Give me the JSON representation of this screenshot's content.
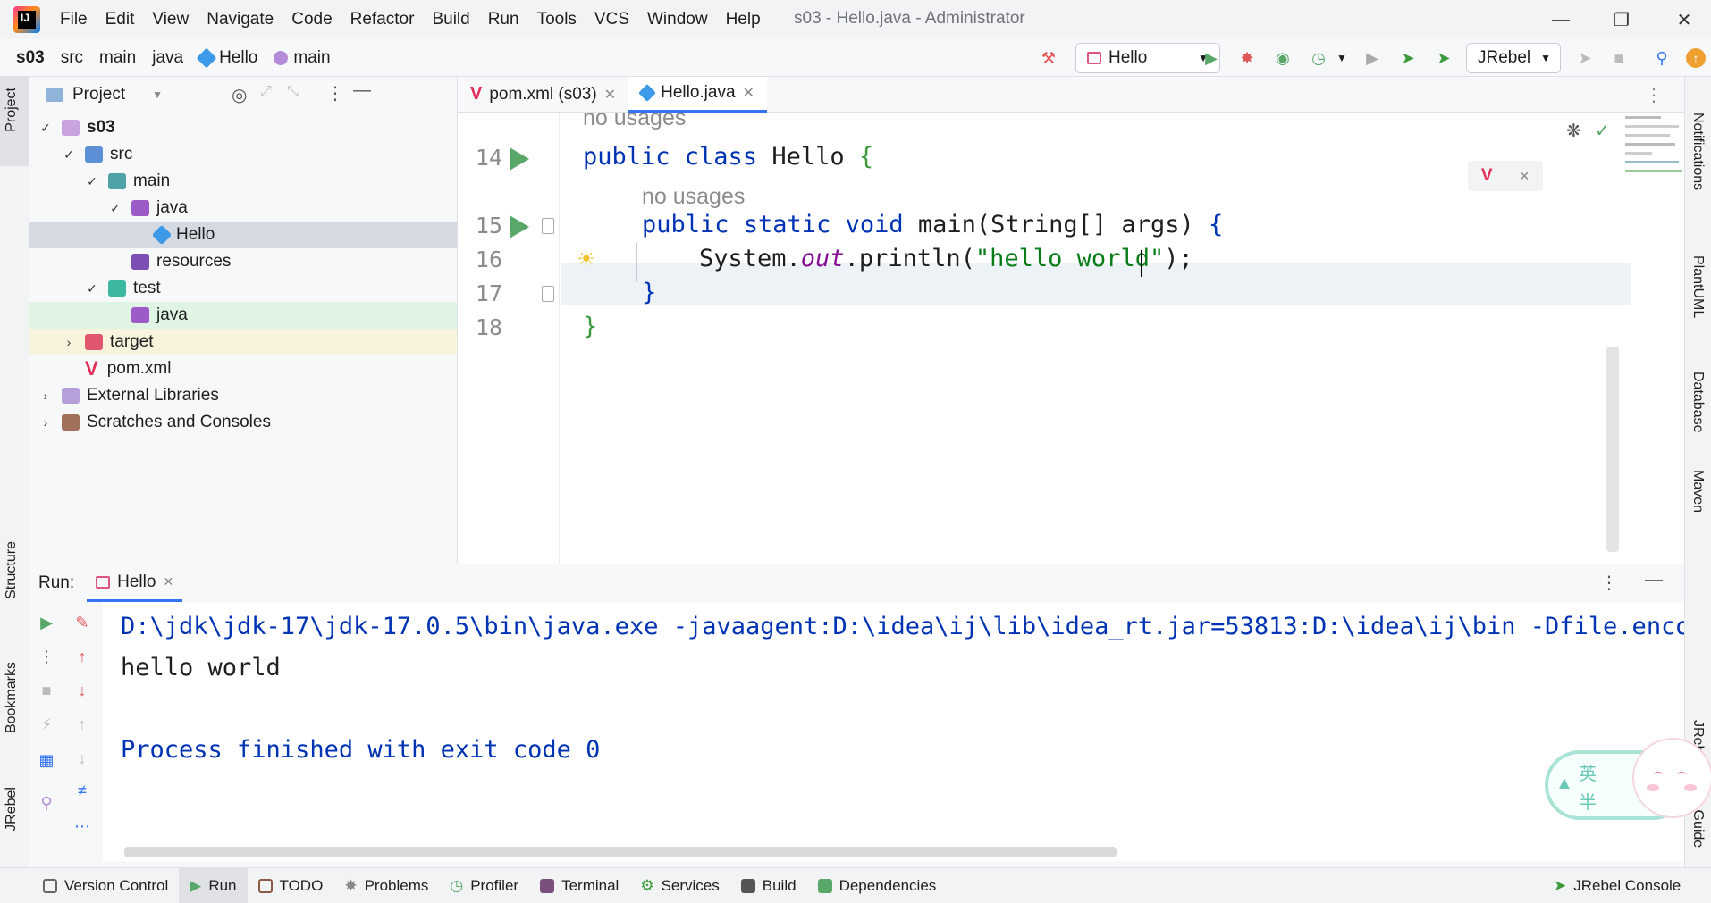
{
  "titlebar": {
    "logo_text": "IJ",
    "menu": [
      "File",
      "Edit",
      "View",
      "Navigate",
      "Code",
      "Refactor",
      "Build",
      "Run",
      "Tools",
      "VCS",
      "Window",
      "Help"
    ],
    "window_title": "s03 - Hello.java - Administrator"
  },
  "navbar": {
    "crumbs": [
      "s03",
      "src",
      "main",
      "java",
      "Hello",
      "main"
    ],
    "run_config": "Hello",
    "jrebel_select": "JRebel"
  },
  "left_strip": {
    "project": "Project",
    "structure": "Structure",
    "bookmarks": "Bookmarks",
    "jrebel": "JRebel"
  },
  "right_strip": {
    "notifications": "Notifications",
    "plantuml": "PlantUML",
    "database": "Database",
    "maven": "Maven",
    "jrebel_setup": "JRebel Setup Guide"
  },
  "project_panel": {
    "title": "Project",
    "tree": [
      {
        "label": "s03",
        "indent": 0,
        "chevron": "open"
      },
      {
        "label": "src",
        "indent": 1,
        "chevron": "open"
      },
      {
        "label": "main",
        "indent": 2,
        "chevron": "open"
      },
      {
        "label": "java",
        "indent": 3,
        "chevron": "open"
      },
      {
        "label": "Hello",
        "indent": 4,
        "chevron": "none"
      },
      {
        "label": "resources",
        "indent": 3,
        "chevron": "none"
      },
      {
        "label": "test",
        "indent": 2,
        "chevron": "open"
      },
      {
        "label": "java",
        "indent": 3,
        "chevron": "none"
      },
      {
        "label": "target",
        "indent": 1,
        "chevron": "closed"
      },
      {
        "label": "pom.xml",
        "indent": 1,
        "chevron": "none"
      },
      {
        "label": "External Libraries",
        "indent": 0,
        "chevron": "closed"
      },
      {
        "label": "Scratches and Consoles",
        "indent": 0,
        "chevron": "closed"
      }
    ]
  },
  "editor": {
    "tabs": [
      {
        "label": "pom.xml (s03)",
        "active": false
      },
      {
        "label": "Hello.java",
        "active": true
      }
    ],
    "hint_top": "no usages",
    "hint_method": "no usages",
    "line_numbers": [
      "14",
      "15",
      "16",
      "17",
      "18"
    ],
    "code": {
      "l14_kw": "public class ",
      "l14_name": "Hello ",
      "l14_brace": "{",
      "l15_kw": "public static void ",
      "l15_rest": "main(String[] args) ",
      "l15_brace": "{",
      "l16_a": "System.",
      "l16_out": "out",
      "l16_b": ".println(",
      "l16_str": "\"hello world\"",
      "l16_c": ");",
      "l17": "}",
      "l18": "}"
    }
  },
  "run_panel": {
    "label": "Run:",
    "tab": "Hello",
    "console": [
      "D:\\jdk\\jdk-17\\jdk-17.0.5\\bin\\java.exe -javaagent:D:\\idea\\ij\\lib\\idea_rt.jar=53813:D:\\idea\\ij\\bin -Dfile.encod",
      "hello world",
      "",
      "Process finished with exit code 0"
    ]
  },
  "widget": {
    "char1": "英",
    "char2": "半"
  },
  "bottombar": {
    "tools": [
      "Version Control",
      "Run",
      "TODO",
      "Problems",
      "Profiler",
      "Terminal",
      "Services",
      "Build",
      "Dependencies"
    ],
    "right": "JRebel Console"
  },
  "colors": {
    "accent": "#3574f0",
    "run_green": "#59a869",
    "keyword": "#0033b3",
    "string": "#067d17"
  }
}
